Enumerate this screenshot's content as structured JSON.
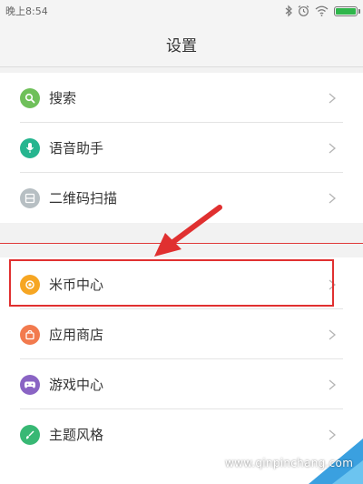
{
  "status_bar": {
    "time": "晚上8:54",
    "icons": [
      "bluetooth-icon",
      "alarm-icon",
      "wifi-icon",
      "battery-icon"
    ],
    "battery_color": "#2fb64b"
  },
  "header": {
    "title": "设置"
  },
  "groups": [
    {
      "items": [
        {
          "label": "搜索",
          "icon": "search-icon",
          "color": "#6fc05a"
        },
        {
          "label": "语音助手",
          "icon": "microphone-icon",
          "color": "#26b58f"
        },
        {
          "label": "二维码扫描",
          "icon": "qr-scan-icon",
          "color": "#b7bfc3"
        }
      ]
    },
    {
      "items": [
        {
          "label": "米币中心",
          "icon": "coin-icon",
          "color": "#f6a623",
          "highlighted": true
        },
        {
          "label": "应用商店",
          "icon": "store-bag-icon",
          "color": "#f27a4e"
        },
        {
          "label": "游戏中心",
          "icon": "gamepad-icon",
          "color": "#8a64c4"
        },
        {
          "label": "主题风格",
          "icon": "brush-icon",
          "color": "#38b874"
        }
      ]
    }
  ],
  "annotation": {
    "highlight_color": "#e03030"
  },
  "watermark": "www.qinpinchang.com"
}
